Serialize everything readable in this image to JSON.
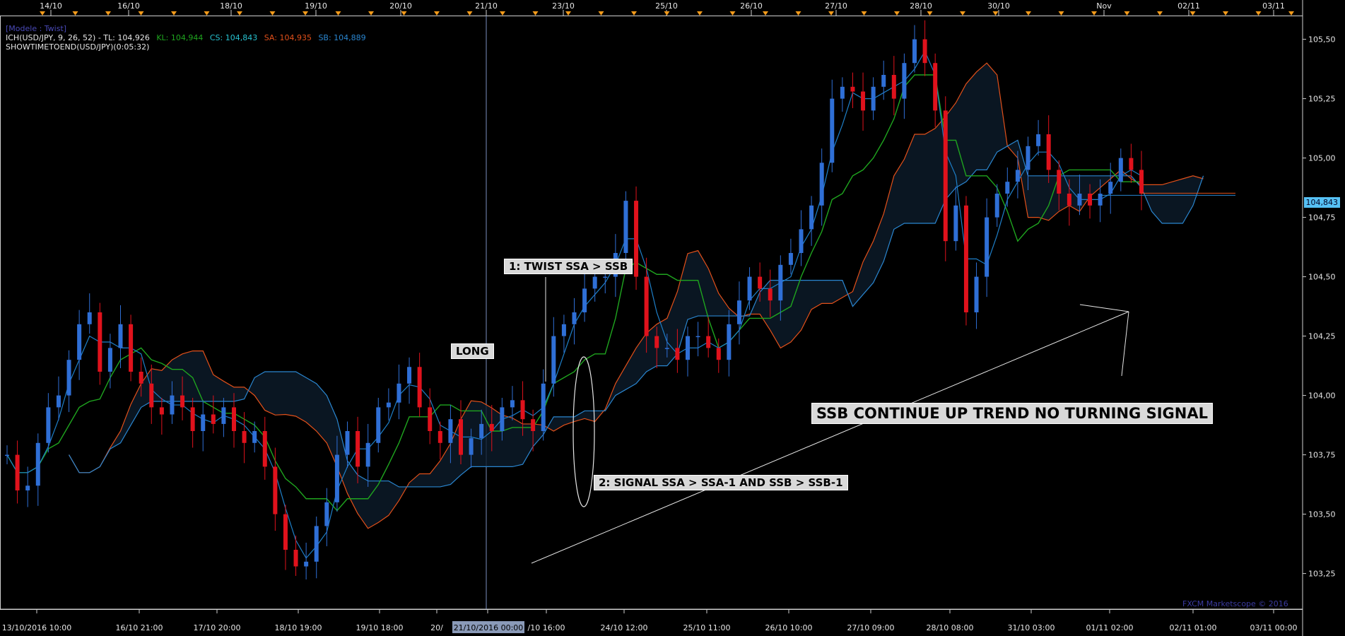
{
  "header": {
    "model": "[Modele : Twist]",
    "ich_prefix": "ICH(USD/JPY, 9, 26, 52) -  TL: 104,926",
    "kl": "KL: 104,944",
    "cs": "CS: 104,843",
    "sa": "SA: 104,935",
    "sb": "SB: 104,889",
    "timer": "SHOWTIMETOEND(USD/JPY)(0:05:32)"
  },
  "colors": {
    "background": "#000000",
    "bull_candle": "#2f6fd6",
    "bear_candle": "#e0121c",
    "tenkan": "#1e7fc8",
    "kijun": "#1fa51f",
    "ssa": "#e2501a",
    "ssb": "#2a86d0",
    "price_tag": "#56c1f4"
  },
  "top_axis_labels": [
    "14/10",
    "16/10",
    "18/10",
    "19/10",
    "20/10",
    "21/10",
    "23/10",
    "25/10",
    "26/10",
    "27/10",
    "28/10",
    "30/10",
    "Nov",
    "02/11",
    "03/11"
  ],
  "bottom_axis_labels": [
    "13/10/2016 10:00",
    "16/10 21:00",
    "17/10 20:00",
    "18/10 19:00",
    "19/10 18:00",
    "20/",
    "21/10/2016 00:00",
    "/10 16:00",
    "24/10 12:00",
    "25/10 11:00",
    "26/10 10:00",
    "27/10 09:00",
    "28/10 08:00",
    "31/10 03:00",
    "01/11 02:00",
    "02/11 01:00",
    "03/11 00:00"
  ],
  "price_axis_labels": [
    "105,50",
    "105,25",
    "105,00",
    "104,75",
    "104,50",
    "104,25",
    "104,00",
    "103,75",
    "103,50",
    "103,25"
  ],
  "current_price": "104,843",
  "annotations": {
    "long": "LONG",
    "twist": "1: TWIST SSA > SSB",
    "signal": "2: SIGNAL SSA > SSA-1 AND SSB > SSB-1",
    "trend": "SSB CONTINUE UP TREND NO TURNING SIGNAL"
  },
  "watermark": "FXCM Marketscope © 2016",
  "chart_data": {
    "type": "candlestick",
    "instrument": "USD/JPY",
    "ylim": [
      103.1,
      105.6
    ],
    "y_ticks": [
      103.25,
      103.5,
      103.75,
      104.0,
      104.25,
      104.5,
      104.75,
      105.0,
      105.25,
      105.5
    ],
    "current_price": 104.843,
    "close_series": [
      103.75,
      103.6,
      103.62,
      103.8,
      103.95,
      104.0,
      104.15,
      104.3,
      104.35,
      104.1,
      104.2,
      104.3,
      104.1,
      104.05,
      103.95,
      103.92,
      104.0,
      103.95,
      103.85,
      103.92,
      103.88,
      103.95,
      103.85,
      103.8,
      103.85,
      103.7,
      103.5,
      103.35,
      103.28,
      103.3,
      103.45,
      103.55,
      103.75,
      103.85,
      103.7,
      103.8,
      103.95,
      103.97,
      104.05,
      104.12,
      103.95,
      103.85,
      103.8,
      103.9,
      103.75,
      103.82,
      103.88,
      103.85,
      103.95,
      103.98,
      103.9,
      103.85,
      104.05,
      104.25,
      104.3,
      104.35,
      104.45,
      104.5,
      104.5,
      104.6,
      104.82,
      104.5,
      104.25,
      104.2,
      104.2,
      104.15,
      104.25,
      104.25,
      104.2,
      104.15,
      104.3,
      104.4,
      104.5,
      104.45,
      104.4,
      104.55,
      104.6,
      104.7,
      104.8,
      104.98,
      105.25,
      105.3,
      105.28,
      105.2,
      105.3,
      105.35,
      105.25,
      105.4,
      105.5,
      105.4,
      105.2,
      104.65,
      104.8,
      104.35,
      104.5,
      104.75,
      104.85,
      104.9,
      104.95,
      105.05,
      105.1,
      104.95,
      104.85,
      104.8,
      104.85,
      104.8,
      104.85,
      104.9,
      105.0,
      104.95,
      104.85
    ],
    "tenkan_kl": 104.944,
    "kijun_label_value": 104.926,
    "chikou_cs": 104.843,
    "senkou_a_sa": 104.935,
    "senkou_b_sb": 104.889
  }
}
